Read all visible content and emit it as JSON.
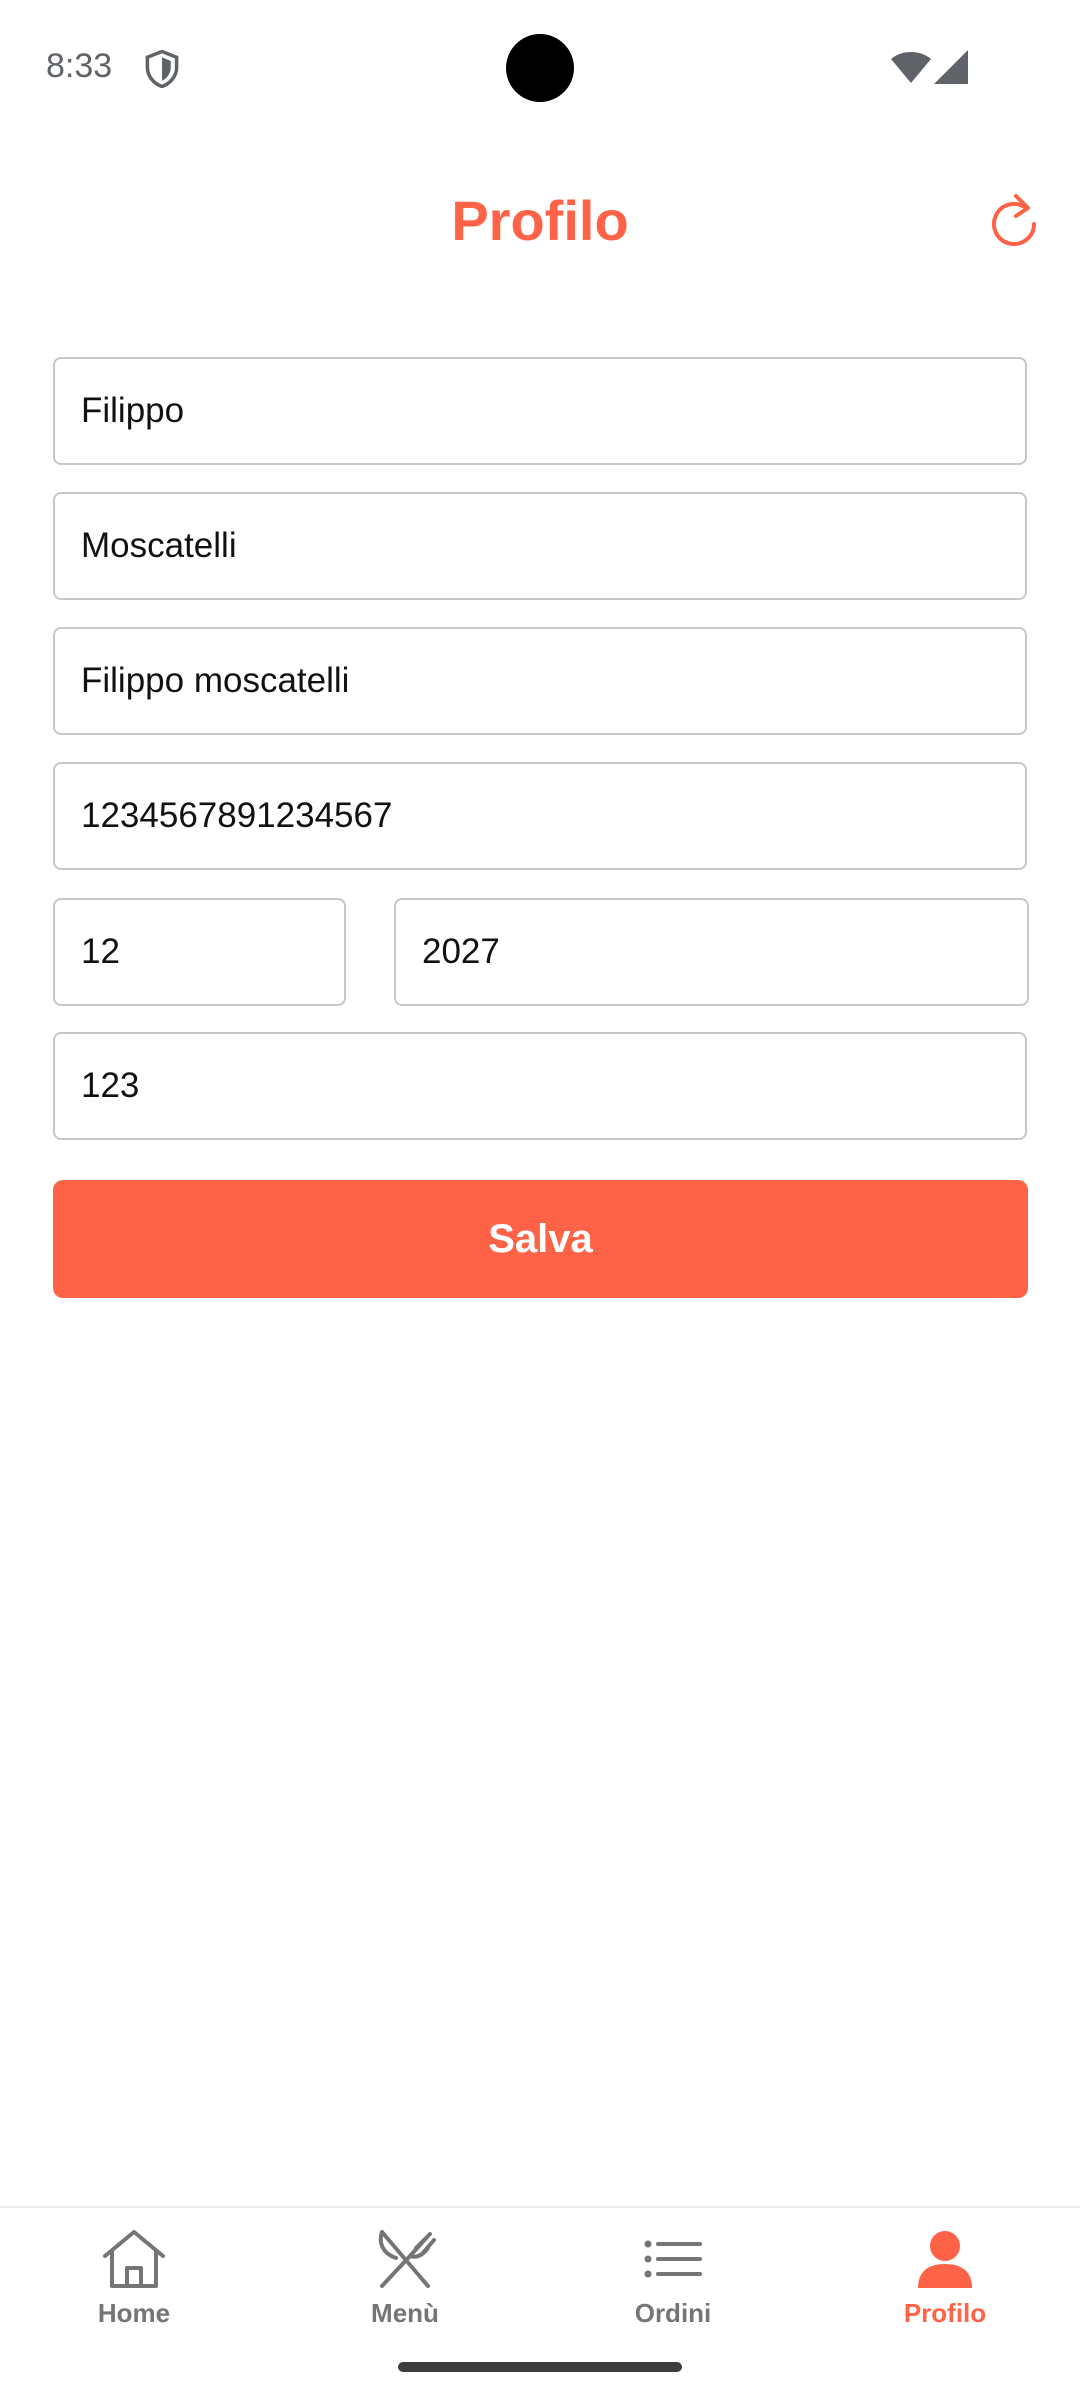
{
  "status_bar": {
    "time": "8:33",
    "icons": [
      "shield-icon",
      "wifi-icon",
      "signal-icon"
    ]
  },
  "header": {
    "title": "Profilo",
    "refresh_icon": "refresh-icon"
  },
  "form": {
    "first_name": "Filippo",
    "last_name": "Moscatelli",
    "card_holder": "Filippo moscatelli",
    "card_number": "1234567891234567",
    "expiry_month": "12",
    "expiry_year": "2027",
    "cvv": "123"
  },
  "save_label": "Salva",
  "bottom_nav": {
    "items": [
      {
        "label": "Home",
        "icon": "home-icon",
        "active": false
      },
      {
        "label": "Menù",
        "icon": "cutlery-icon",
        "active": false
      },
      {
        "label": "Ordini",
        "icon": "list-icon",
        "active": false
      },
      {
        "label": "Profilo",
        "icon": "person-icon",
        "active": true
      }
    ]
  },
  "colors": {
    "accent": "#ff6347",
    "inactive": "#757575",
    "border": "#c8c8c8"
  }
}
